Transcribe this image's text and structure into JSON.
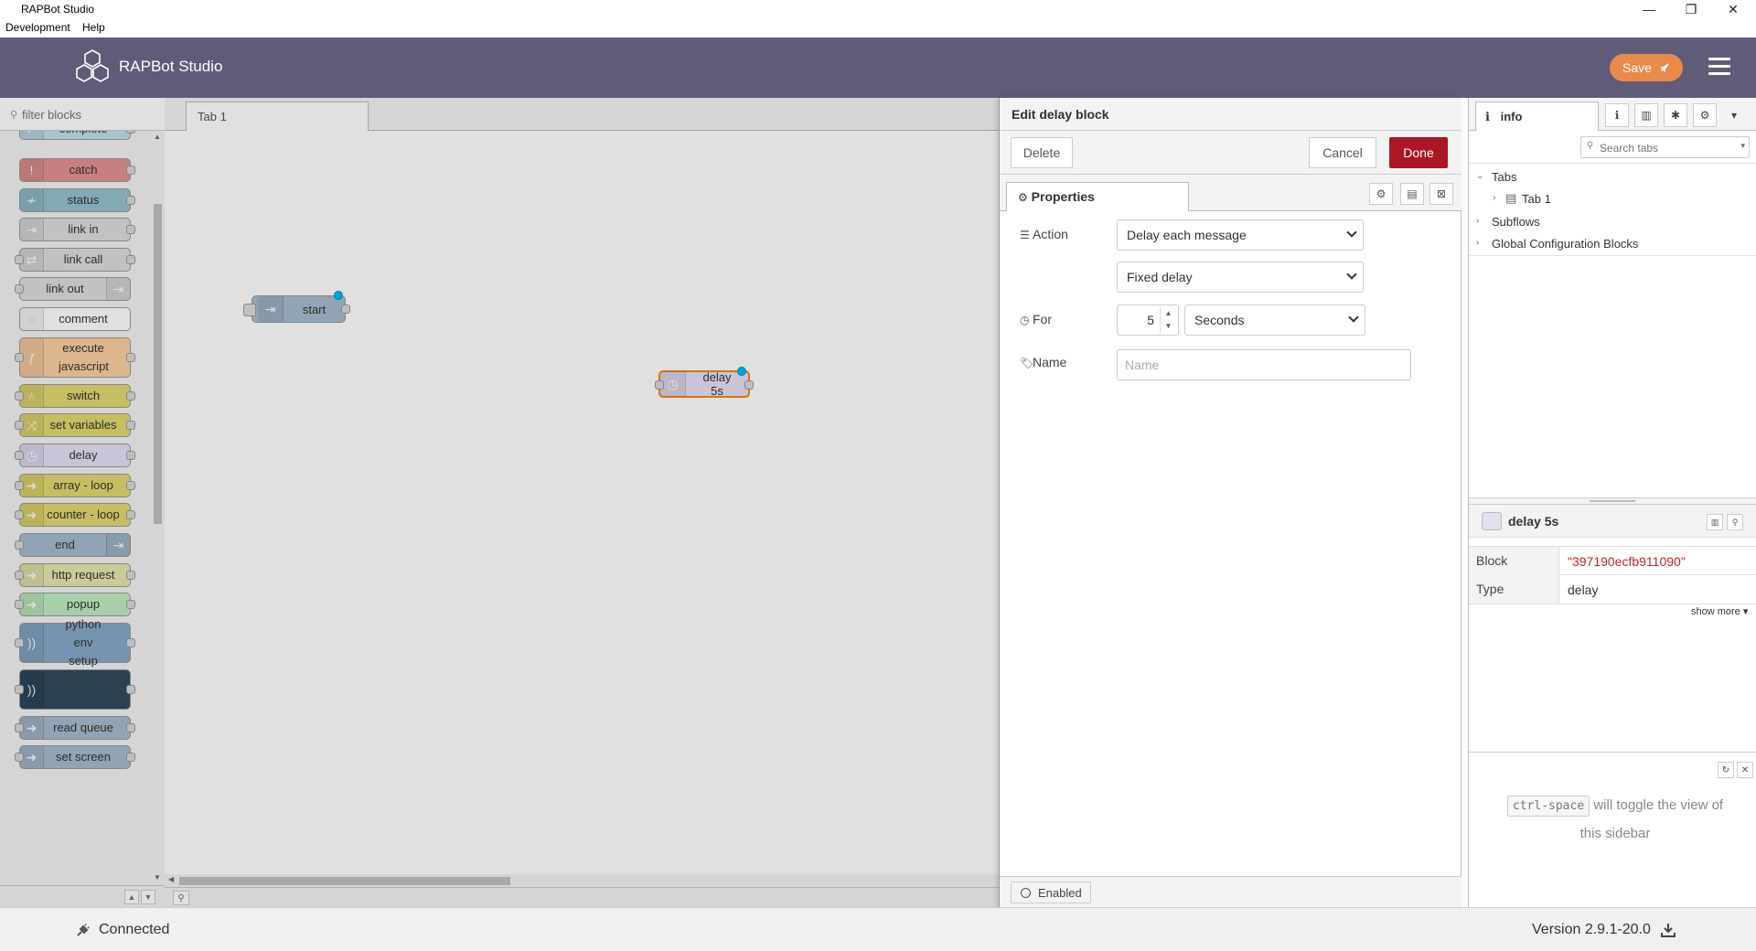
{
  "window": {
    "title": "RAPBot Studio",
    "minimize": "—",
    "restore": "❐",
    "close": "✕"
  },
  "menu": [
    "Development",
    "Help"
  ],
  "header": {
    "brand": "RAPBot Studio",
    "save_label": "Save"
  },
  "palette": {
    "filter_placeholder": "filter blocks",
    "items": [
      {
        "label": "complete",
        "color": "#c0deed"
      },
      {
        "label": "catch",
        "color": "#e49191"
      },
      {
        "label": "status",
        "color": "#94c1d0"
      },
      {
        "label": "link in",
        "color": "#dddddd"
      },
      {
        "label": "link call",
        "color": "#dddddd"
      },
      {
        "label": "link out",
        "color": "#dddddd"
      },
      {
        "label": "comment",
        "color": "#ffffff"
      },
      {
        "label": "execute javascript",
        "color": "#fdd0a2"
      },
      {
        "label": "switch",
        "color": "#e2d96e"
      },
      {
        "label": "set variables",
        "color": "#e2d96e"
      },
      {
        "label": "delay",
        "color": "#e6e0f8"
      },
      {
        "label": "array - loop",
        "color": "#e2d96e"
      },
      {
        "label": "counter - loop",
        "color": "#e2d96e"
      },
      {
        "label": "end",
        "color": "#a6bbcf"
      },
      {
        "label": "http request",
        "color": "#e7e7ae"
      },
      {
        "label": "popup",
        "color": "#c0edc0"
      },
      {
        "label": "python env setup",
        "color": "#87a9c9"
      },
      {
        "label": "",
        "color": "#2f4a5f"
      },
      {
        "label": "read queue",
        "color": "#a6bbcf"
      },
      {
        "label": "set screen",
        "color": "#a6bbcf"
      }
    ]
  },
  "workspace": {
    "tab_label": "Tab 1",
    "nodes": [
      {
        "label": "start",
        "color": "#a6bbcf"
      },
      {
        "label": "delay 5s",
        "color": "#e6e0f8"
      }
    ]
  },
  "editor": {
    "title": "Edit delay block",
    "delete_label": "Delete",
    "cancel_label": "Cancel",
    "done_label": "Done",
    "properties_tab": "Properties",
    "action_label": "Action",
    "action_value": "Delay each message",
    "delay_type_value": "Fixed delay",
    "for_label": "For",
    "for_value": "5",
    "units_value": "Seconds",
    "name_label": "Name",
    "name_placeholder": "Name",
    "enabled_label": "Enabled"
  },
  "sidebar": {
    "tab_label": "info",
    "search_placeholder": "Search tabs",
    "tree": {
      "tabs": "Tabs",
      "tab1": "Tab 1",
      "subflows": "Subflows",
      "global_config": "Global Configuration Blocks"
    },
    "node_title": "delay 5s",
    "props": [
      {
        "key": "Block",
        "value": "\"397190ecfb911090\""
      },
      {
        "key": "Type",
        "value": "delay"
      }
    ],
    "show_more": "show more ▾",
    "help": {
      "shortcut": "ctrl-space",
      "text1": "will toggle the view of",
      "text2": "this sidebar"
    }
  },
  "status": {
    "connected": "Connected",
    "version": "Version 2.9.1-20.0"
  },
  "colors": {
    "header": "#5f5c79",
    "save": "#e88a4a",
    "done": "#ad1625"
  }
}
